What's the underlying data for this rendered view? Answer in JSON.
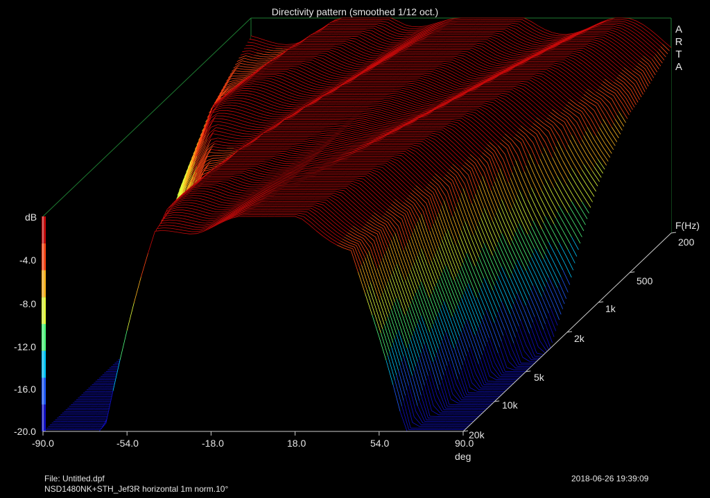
{
  "chart_data": {
    "type": "waterfall-3d",
    "title": "Directivity pattern (smoothed 1/12 oct.)",
    "brand": [
      "A",
      "R",
      "T",
      "A"
    ],
    "z_unit_label": "dB",
    "z_ticks": [
      "-4.0",
      "-8.0",
      "-12.0",
      "-16.0",
      "-20.0"
    ],
    "z_range": [
      -20,
      0
    ],
    "x_label": "deg",
    "x_ticks": [
      "-90.0",
      "-54.0",
      "-18.0",
      "18.0",
      "54.0",
      "90.0"
    ],
    "x_range": [
      -90,
      90
    ],
    "y_label": "F(Hz)",
    "y_ticks": [
      "200",
      "500",
      "1k",
      "2k",
      "5k",
      "10k",
      "20k"
    ],
    "y_scale": "log",
    "y_range_hz": [
      200,
      20000
    ],
    "colormap": [
      "#1010c8",
      "#1e5aff",
      "#00c8ff",
      "#50ff80",
      "#e6ff3c",
      "#ffb41e",
      "#ff4614",
      "#c80a0a"
    ],
    "grid": false,
    "beamwidth_deg_by_freq": [
      {
        "freq_hz": 200,
        "halfwidth_deg": 90
      },
      {
        "freq_hz": 500,
        "halfwidth_deg": 85
      },
      {
        "freq_hz": 1000,
        "halfwidth_deg": 75
      },
      {
        "freq_hz": 2000,
        "halfwidth_deg": 62
      },
      {
        "freq_hz": 5000,
        "halfwidth_deg": 52
      },
      {
        "freq_hz": 10000,
        "halfwidth_deg": 47
      },
      {
        "freq_hz": 20000,
        "halfwidth_deg": 42
      }
    ]
  },
  "footer": {
    "file": "File: Untitled.dpf",
    "description": "NSD1480NK+STH_Jef3R horizontal 1m norm.10°",
    "timestamp": "2018-06-26   19:39:09"
  }
}
